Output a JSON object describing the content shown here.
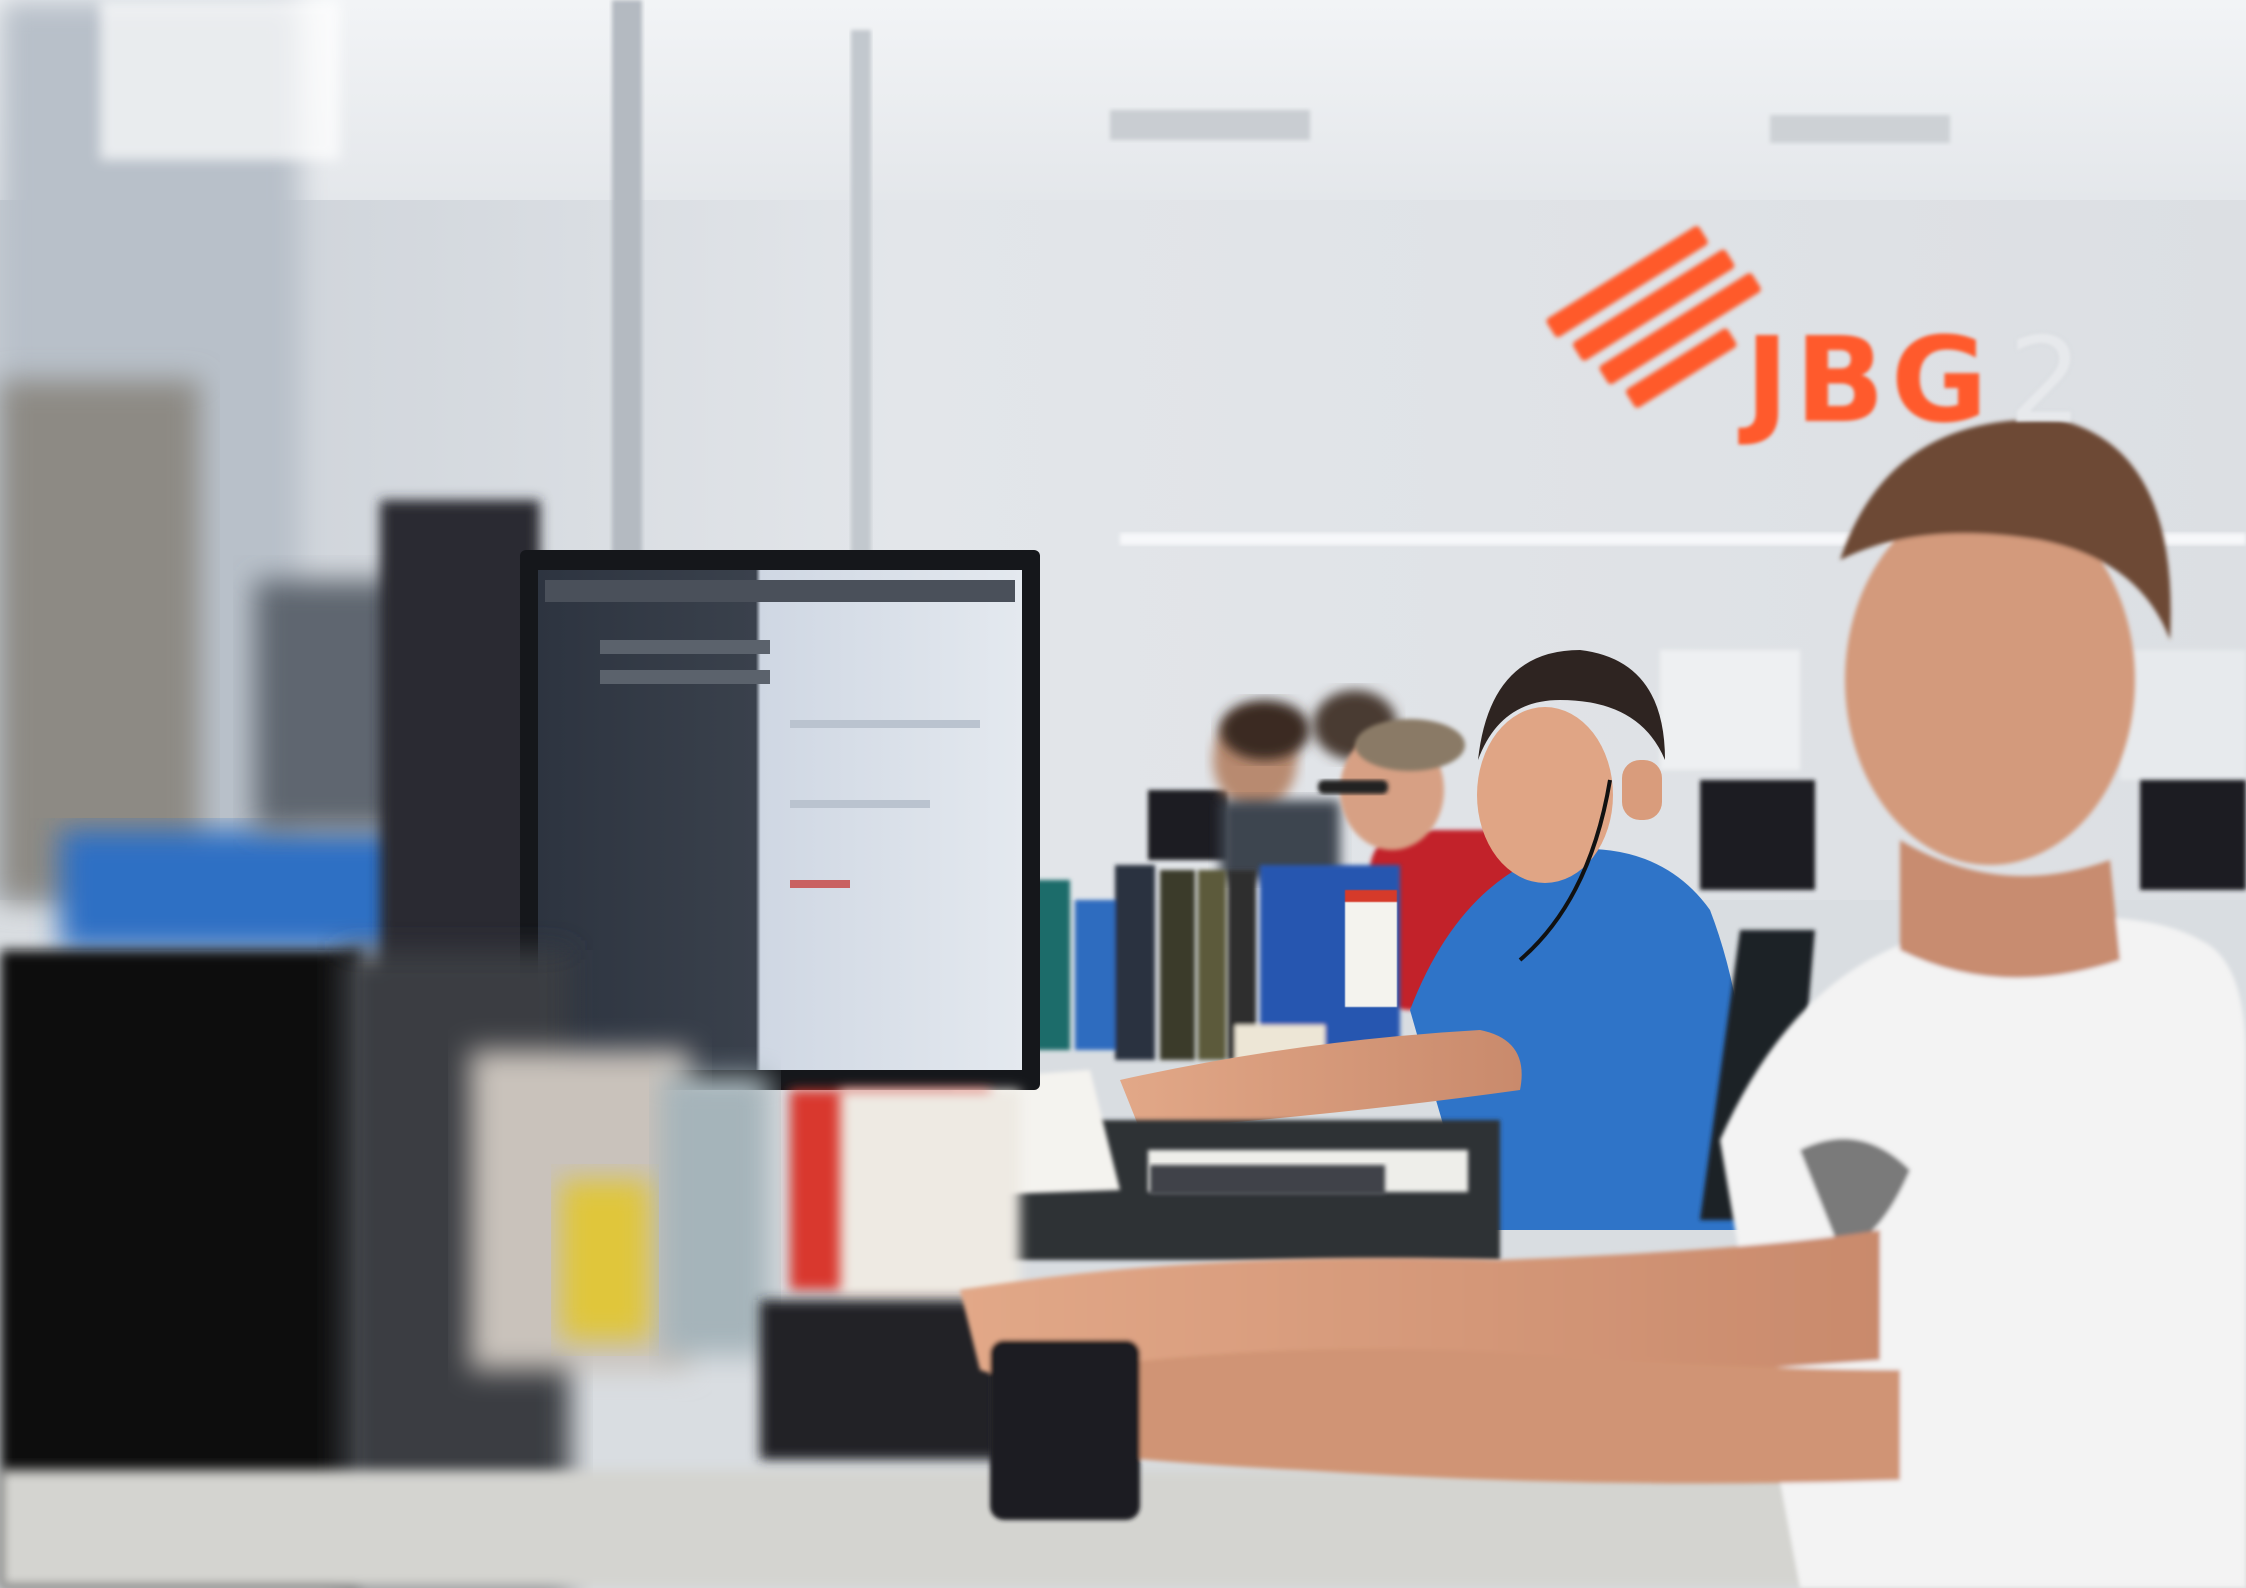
{
  "logo": {
    "word": "JBG",
    "number": "2",
    "mark_color": "#ff5a2c"
  },
  "scene": {
    "description_tags": [
      "office",
      "developers",
      "monitors",
      "desks"
    ],
    "palette": {
      "wall": "#dde1e6",
      "ceiling": "#e8ebee",
      "blue_shirt": "#2f74c8",
      "white_shirt": "#f3f3f3",
      "red_shirt": "#c2202a"
    }
  }
}
